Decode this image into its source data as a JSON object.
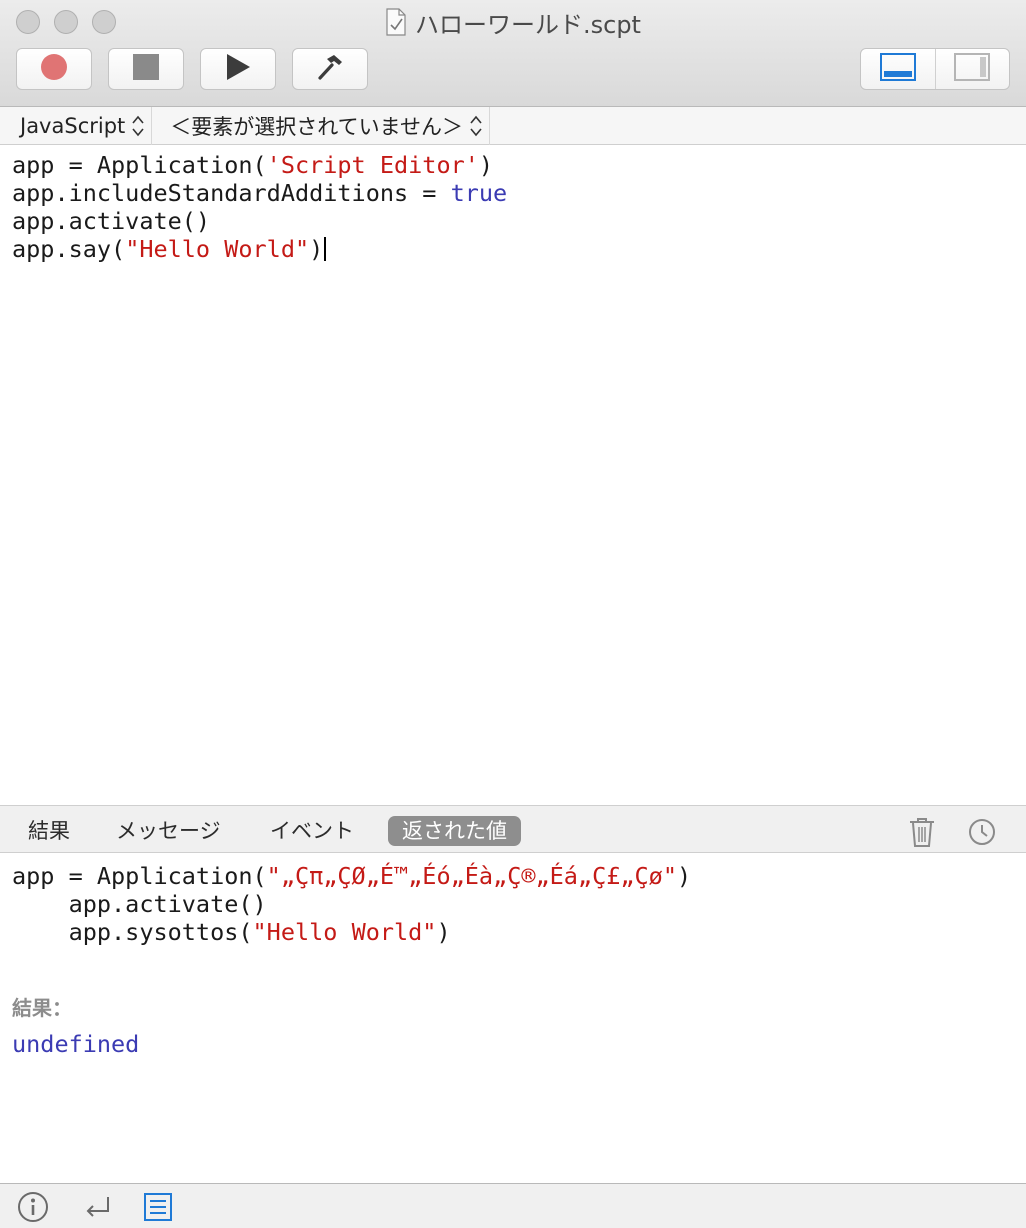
{
  "window": {
    "title": "ハローワールド.scpt"
  },
  "toolbar": {
    "buttons": [
      {
        "name": "record",
        "icon": "record-icon"
      },
      {
        "name": "stop",
        "icon": "stop-icon"
      },
      {
        "name": "run",
        "icon": "play-icon"
      },
      {
        "name": "compile",
        "icon": "hammer-icon"
      }
    ],
    "view_toggles": [
      "show-bottom-pane-icon",
      "show-side-pane-icon"
    ]
  },
  "navbar": {
    "language": "JavaScript",
    "element": "＜要素が選択されていません＞"
  },
  "editor": {
    "lines": [
      {
        "pre": "app = Application(",
        "str": "'Script Editor'",
        "post": ")"
      },
      {
        "pre": "app.includeStandardAdditions = ",
        "kw": "true"
      },
      {
        "pre": "app.activate()"
      },
      {
        "pre": "app.say(",
        "str": "\"Hello World\"",
        "post": ")"
      }
    ]
  },
  "result_tabs": {
    "tabs": [
      "結果",
      "メッセージ",
      "イベント",
      "返された値"
    ],
    "active": "返された値"
  },
  "result": {
    "lines": [
      {
        "pre": "app = Application(",
        "str": "\"„Çπ„ÇØ„É™„Éó„Éà„Ç®„Éá„Ç£„Çø\"",
        "post": ")"
      },
      {
        "pre": "    app.activate()"
      },
      {
        "pre": "    app.sysottos(",
        "str": "\"Hello World\"",
        "post": ")"
      }
    ],
    "label": "結果：",
    "value": "undefined"
  },
  "colors": {
    "string": "#c41a16",
    "keyword": "#3b3bb3",
    "record": "#e07474",
    "accent": "#1f7ad6"
  }
}
